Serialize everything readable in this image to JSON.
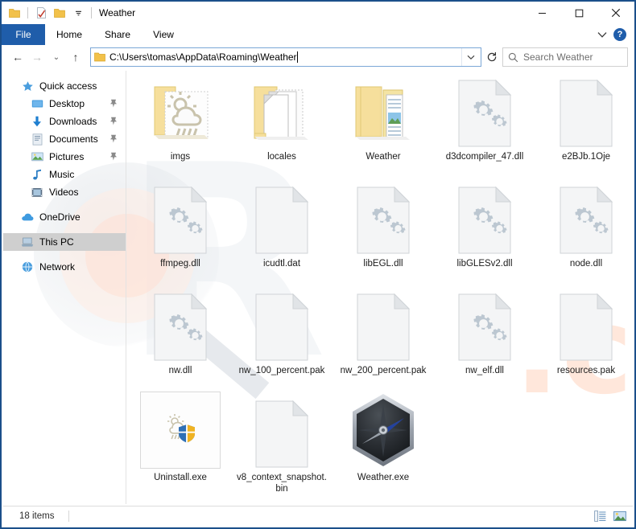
{
  "window": {
    "title": "Weather",
    "quick_access_toolbar": [
      {
        "name": "folder-icon",
        "label": "Folder"
      },
      {
        "name": "properties-icon",
        "label": "Properties"
      },
      {
        "name": "new-folder-icon",
        "label": "New folder"
      },
      {
        "name": "customize-chevron-icon",
        "label": "Customize Quick Access Toolbar"
      }
    ],
    "controls": {
      "minimize": "─",
      "maximize": "☐",
      "close": "✕"
    }
  },
  "ribbon": {
    "tabs": [
      {
        "label": "File",
        "active": true
      },
      {
        "label": "Home",
        "active": false
      },
      {
        "label": "Share",
        "active": false
      },
      {
        "label": "View",
        "active": false
      }
    ],
    "expand_icon": "chevron-down-icon",
    "help_label": "?"
  },
  "addressbar": {
    "back_icon": "←",
    "forward_icon": "→",
    "recent_icon": "⌄",
    "up_icon": "↑",
    "path": "C:\\Users\\tomas\\AppData\\Roaming\\Weather",
    "path_dropdown_icon": "⌄",
    "refresh_icon": "↻",
    "search": {
      "placeholder": "Search Weather",
      "value": "",
      "icon": "search-icon"
    }
  },
  "sidebar": {
    "items": [
      {
        "label": "Quick access",
        "icon": "star-icon",
        "indent": false,
        "selected": false,
        "pinned": false
      },
      {
        "label": "Desktop",
        "icon": "desktop-icon",
        "indent": true,
        "selected": false,
        "pinned": true
      },
      {
        "label": "Downloads",
        "icon": "download-icon",
        "indent": true,
        "selected": false,
        "pinned": true
      },
      {
        "label": "Documents",
        "icon": "document-icon",
        "indent": true,
        "selected": false,
        "pinned": true
      },
      {
        "label": "Pictures",
        "icon": "pictures-icon",
        "indent": true,
        "selected": false,
        "pinned": true
      },
      {
        "label": "Music",
        "icon": "music-icon",
        "indent": true,
        "selected": false,
        "pinned": false
      },
      {
        "label": "Videos",
        "icon": "videos-icon",
        "indent": true,
        "selected": false,
        "pinned": false
      },
      {
        "label": "OneDrive",
        "icon": "cloud-icon",
        "indent": false,
        "selected": false,
        "pinned": false,
        "gap_before": true
      },
      {
        "label": "This PC",
        "icon": "thispc-icon",
        "indent": false,
        "selected": true,
        "pinned": false,
        "gap_before": true
      },
      {
        "label": "Network",
        "icon": "network-icon",
        "indent": false,
        "selected": false,
        "pinned": false,
        "gap_before": true
      }
    ],
    "pin_glyph": "📌"
  },
  "files": [
    {
      "label": "imgs",
      "icon": "folder-weather-thumb-icon",
      "selected": false
    },
    {
      "label": "locales",
      "icon": "folder-docs-thumb-icon",
      "selected": false
    },
    {
      "label": "Weather",
      "icon": "folder-image-thumb-icon",
      "selected": false
    },
    {
      "label": "d3dcompiler_47.dll",
      "icon": "dll-gears-icon",
      "selected": false
    },
    {
      "label": "e2BJb.1Oje",
      "icon": "blank-document-icon",
      "selected": false
    },
    {
      "label": "ffmpeg.dll",
      "icon": "dll-gears-icon",
      "selected": false
    },
    {
      "label": "icudtl.dat",
      "icon": "blank-document-icon",
      "selected": false
    },
    {
      "label": "libEGL.dll",
      "icon": "dll-gears-icon",
      "selected": false
    },
    {
      "label": "libGLESv2.dll",
      "icon": "dll-gears-icon",
      "selected": false
    },
    {
      "label": "node.dll",
      "icon": "dll-gears-icon",
      "selected": false
    },
    {
      "label": "nw.dll",
      "icon": "dll-gears-icon",
      "selected": false
    },
    {
      "label": "nw_100_percent.pak",
      "icon": "blank-document-icon",
      "selected": false
    },
    {
      "label": "nw_200_percent.pak",
      "icon": "blank-document-icon",
      "selected": false
    },
    {
      "label": "nw_elf.dll",
      "icon": "dll-gears-icon",
      "selected": false
    },
    {
      "label": "resources.pak",
      "icon": "blank-document-icon",
      "selected": false
    },
    {
      "label": "Uninstall.exe",
      "icon": "weather-shield-icon",
      "selected": true
    },
    {
      "label": "v8_context_snapshot.bin",
      "icon": "blank-document-icon",
      "selected": false
    },
    {
      "label": "Weather.exe",
      "icon": "compass-hex-icon",
      "selected": false
    }
  ],
  "statusbar": {
    "items_count": "18 items",
    "view_icons": [
      {
        "name": "details-view-icon",
        "label": "Details view"
      },
      {
        "name": "large-icons-view-icon",
        "label": "Large icons view"
      }
    ]
  },
  "colors": {
    "window_border": "#1b4f8a",
    "ribbon_file_tab": "#1f5daa",
    "accent_blue": "#1f5daa",
    "selection_gray": "#cfcfcf",
    "folder_yellow": "#f7dd90",
    "gear_gray": "#b3bfc9",
    "watermark_orange": "#ffdecd"
  },
  "watermark": {
    "text": "...com",
    "glyph": "R"
  }
}
